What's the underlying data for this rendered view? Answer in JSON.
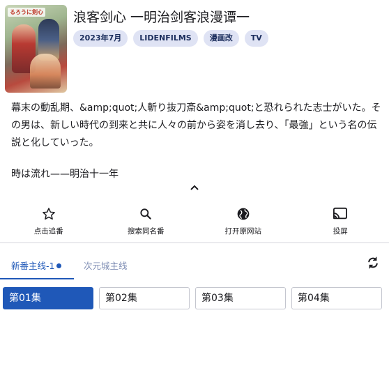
{
  "title": "浪客剑心 一明治剑客浪漫谭一",
  "poster": {
    "title_text": "るろうに剣心"
  },
  "tags": [
    "2023年7月",
    "LIDENFILMS",
    "漫画改",
    "TV"
  ],
  "description": {
    "paragraph1": "幕末の動乱期、&amp;quot;人斬り抜刀斎&amp;quot;と恐れられた志士がいた。その男は、新しい時代の到来と共に人々の前から姿を消し去り、「最強」という名の伝説と化していった。",
    "paragraph2": "時は流れ——明治十一年"
  },
  "collapse_icon": "chevron-up-icon",
  "actions": [
    {
      "label": "点击追番",
      "icon": "star-outline-icon"
    },
    {
      "label": "搜索同名番",
      "icon": "search-icon"
    },
    {
      "label": "打开原网站",
      "icon": "globe-icon"
    },
    {
      "label": "投屏",
      "icon": "cast-icon"
    }
  ],
  "tabs": {
    "active": "新番主线-1",
    "inactive": "次元城主线"
  },
  "refresh_icon": "refresh-icon",
  "episodes": [
    "第01集",
    "第02集",
    "第03集",
    "第04集"
  ],
  "colors": {
    "accent": "#1f58b8",
    "chip_bg": "#dfe3f4",
    "chip_text": "#1b2d5c",
    "inactive_tab": "#7d8cb3"
  }
}
